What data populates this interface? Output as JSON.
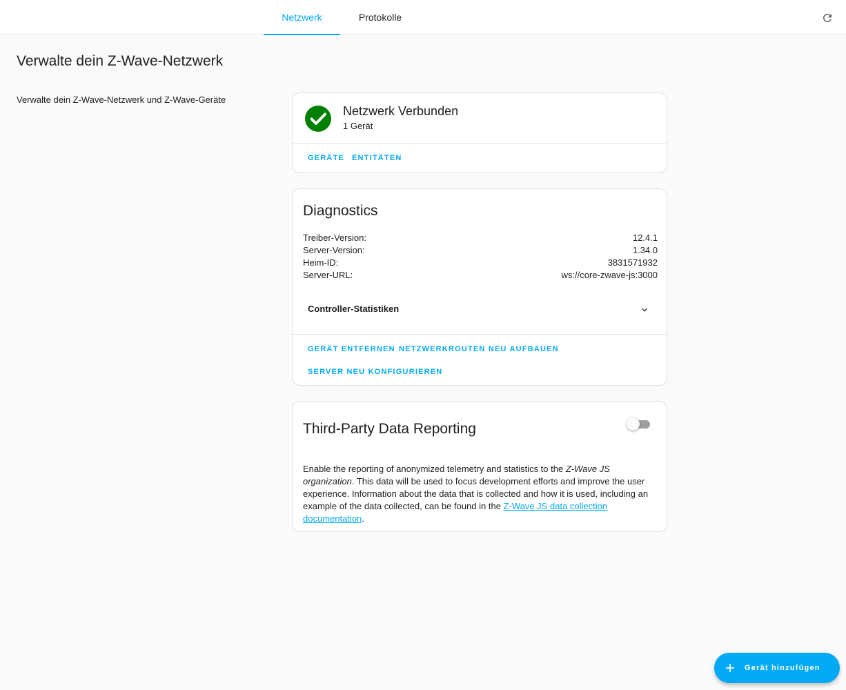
{
  "tabs": {
    "network": "Netzwerk",
    "logs": "Protokolle"
  },
  "header": {
    "title": "Verwalte dein Z-Wave-Netzwerk",
    "description": "Verwalte dein Z-Wave-Netzwerk und Z-Wave-Geräte"
  },
  "status_card": {
    "title": "Netzwerk Verbunden",
    "subtitle": "1 Gerät",
    "actions": {
      "devices": "Geräte",
      "entities": "Entitäten"
    },
    "icon": "check-circle-icon",
    "icon_color": "#008000"
  },
  "diagnostics": {
    "title": "Diagnostics",
    "rows": [
      {
        "label": "Treiber-Version:",
        "value": "12.4.1"
      },
      {
        "label": "Server-Version:",
        "value": "1.34.0"
      },
      {
        "label": "Heim-ID:",
        "value": "3831571932"
      },
      {
        "label": "Server-URL:",
        "value": "ws://core-zwave-js:3000"
      }
    ],
    "controller_stats": "Controller-Statistiken",
    "actions": {
      "remove_device": "Gerät entfernen",
      "rebuild_routes": "Netzwerkrouten neu aufbauen",
      "reconfigure_server": "Server neu konfigurieren"
    }
  },
  "third_party": {
    "title": "Third-Party Data Reporting",
    "toggle_on": false,
    "text_before": "Enable the reporting of anonymized telemetry and statistics to the ",
    "text_org": "Z-Wave JS organization",
    "text_middle": ". This data will be used to focus development efforts and improve the user experience. Information about the data that is collected and how it is used, including an example of the data collected, can be found in the ",
    "link_text": "Z-Wave JS data collection documentation",
    "text_after": "."
  },
  "fab": {
    "label": "Gerät hinzufügen",
    "icon": "plus-icon"
  },
  "colors": {
    "accent": "#03a9f4",
    "success": "#008000",
    "background": "#fafafa"
  }
}
